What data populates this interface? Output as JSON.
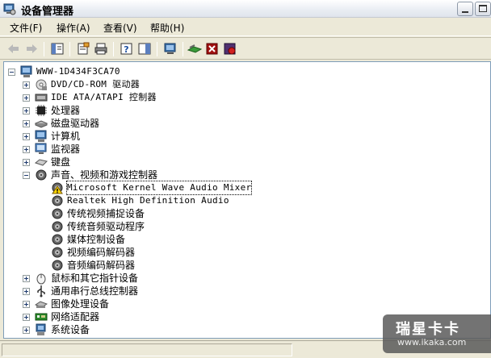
{
  "window": {
    "title": "设备管理器"
  },
  "menu": [
    {
      "label": "文件(F)"
    },
    {
      "label": "操作(A)"
    },
    {
      "label": "查看(V)"
    },
    {
      "label": "帮助(H)"
    }
  ],
  "tree": {
    "root": "WWW-1D434F3CA70",
    "items": [
      {
        "label": "DVD/CD-ROM 驱动器",
        "mono": true,
        "expanded": false,
        "icon": "cdrom-icon"
      },
      {
        "label": "IDE ATA/ATAPI 控制器",
        "mono": true,
        "expanded": false,
        "icon": "ide-controller-icon"
      },
      {
        "label": "处理器",
        "mono": false,
        "expanded": false,
        "icon": "processor-icon"
      },
      {
        "label": "磁盘驱动器",
        "mono": false,
        "expanded": false,
        "icon": "disk-drive-icon"
      },
      {
        "label": "计算机",
        "mono": false,
        "expanded": false,
        "icon": "computer-icon"
      },
      {
        "label": "监视器",
        "mono": false,
        "expanded": false,
        "icon": "monitor-icon"
      },
      {
        "label": "键盘",
        "mono": false,
        "expanded": false,
        "icon": "keyboard-icon"
      },
      {
        "label": "声音、视频和游戏控制器",
        "mono": false,
        "expanded": true,
        "icon": "sound-icon",
        "children": [
          {
            "label": "Microsoft Kernel Wave Audio Mixer",
            "mono": true,
            "warning": true,
            "selected": true
          },
          {
            "label": "Realtek High Definition Audio",
            "mono": true
          },
          {
            "label": "传统视频捕捉设备",
            "mono": false
          },
          {
            "label": "传统音频驱动程序",
            "mono": false
          },
          {
            "label": "媒体控制设备",
            "mono": false
          },
          {
            "label": "视频编码解码器",
            "mono": false
          },
          {
            "label": "音频编码解码器",
            "mono": false
          }
        ]
      },
      {
        "label": "鼠标和其它指针设备",
        "mono": false,
        "expanded": false,
        "icon": "mouse-icon"
      },
      {
        "label": "通用串行总线控制器",
        "mono": false,
        "expanded": false,
        "icon": "usb-icon"
      },
      {
        "label": "图像处理设备",
        "mono": false,
        "expanded": false,
        "icon": "scanner-icon"
      },
      {
        "label": "网络适配器",
        "mono": false,
        "expanded": false,
        "icon": "network-adapter-icon"
      },
      {
        "label": "系统设备",
        "mono": false,
        "expanded": false,
        "icon": "system-device-icon"
      }
    ]
  },
  "watermark": {
    "main": "瑞星卡卡",
    "sub": "www.ikaka.com"
  }
}
